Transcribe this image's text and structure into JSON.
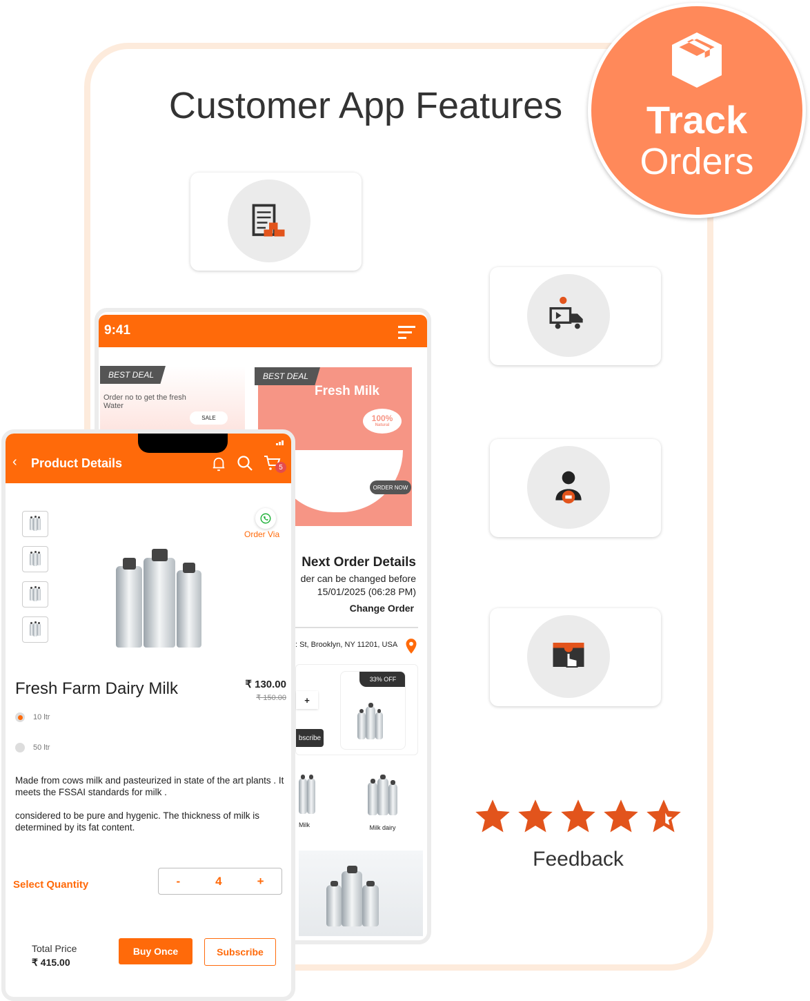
{
  "title": "Customer App Features",
  "track": {
    "line1": "Track",
    "line2": "Orders",
    "icon": "box-icon"
  },
  "features": [
    {
      "icon": "checklist-boxes-icon"
    },
    {
      "icon": "delivery-truck-location-icon"
    },
    {
      "icon": "user-delivery-icon"
    },
    {
      "icon": "tap-order-box-icon"
    }
  ],
  "feedback": {
    "label": "Feedback",
    "rating": 4.5,
    "max": 5
  },
  "colors": {
    "accent": "#ff6a0a",
    "track": "#ff895a",
    "star": "#e2541c"
  },
  "back_phone": {
    "time": "9:41",
    "banner1": {
      "badge": "BEST DEAL",
      "text": "Order no to get the fresh Water",
      "button": "SALE"
    },
    "banner2": {
      "badge": "BEST DEAL",
      "title": "Fresh Milk",
      "badge2": "100%",
      "badge2_sub": "Natural",
      "button": "ORDER NOW"
    },
    "next_order": {
      "title": "Next Order Details",
      "line1": "der can be changed before",
      "line2": "15/01/2025 (06:28 PM)",
      "action": "Change Order"
    },
    "address": ": St, Brooklyn, NY 11201, USA",
    "product_card": {
      "discount": "33% OFF",
      "plus": "+",
      "subscribe": "bscribe"
    },
    "categories": [
      {
        "label": "Milk"
      },
      {
        "label": "Milk dairy"
      }
    ]
  },
  "front_phone": {
    "header": {
      "title": "Product Details",
      "cart_count": "5"
    },
    "order_via": "Order Via",
    "product": {
      "name": "Fresh Farm Dairy Milk",
      "price": "₹ 130.00",
      "old_price": "₹ 150.00"
    },
    "options": [
      {
        "label": "10 ltr",
        "selected": true
      },
      {
        "label": "50 ltr",
        "selected": false
      }
    ],
    "description1": "Made from cows milk and pasteurized in state of the art plants . It meets the FSSAI standards for milk .",
    "description2": "considered to be pure and hygenic. The thickness of milk is determined by its fat content.",
    "quantity": {
      "label": "Select Quantity",
      "minus": "-",
      "value": "4",
      "plus": "+"
    },
    "total": {
      "label": "Total Price",
      "value": "₹ 415.00"
    },
    "buy_once": "Buy Once",
    "subscribe": "Subscribe"
  }
}
